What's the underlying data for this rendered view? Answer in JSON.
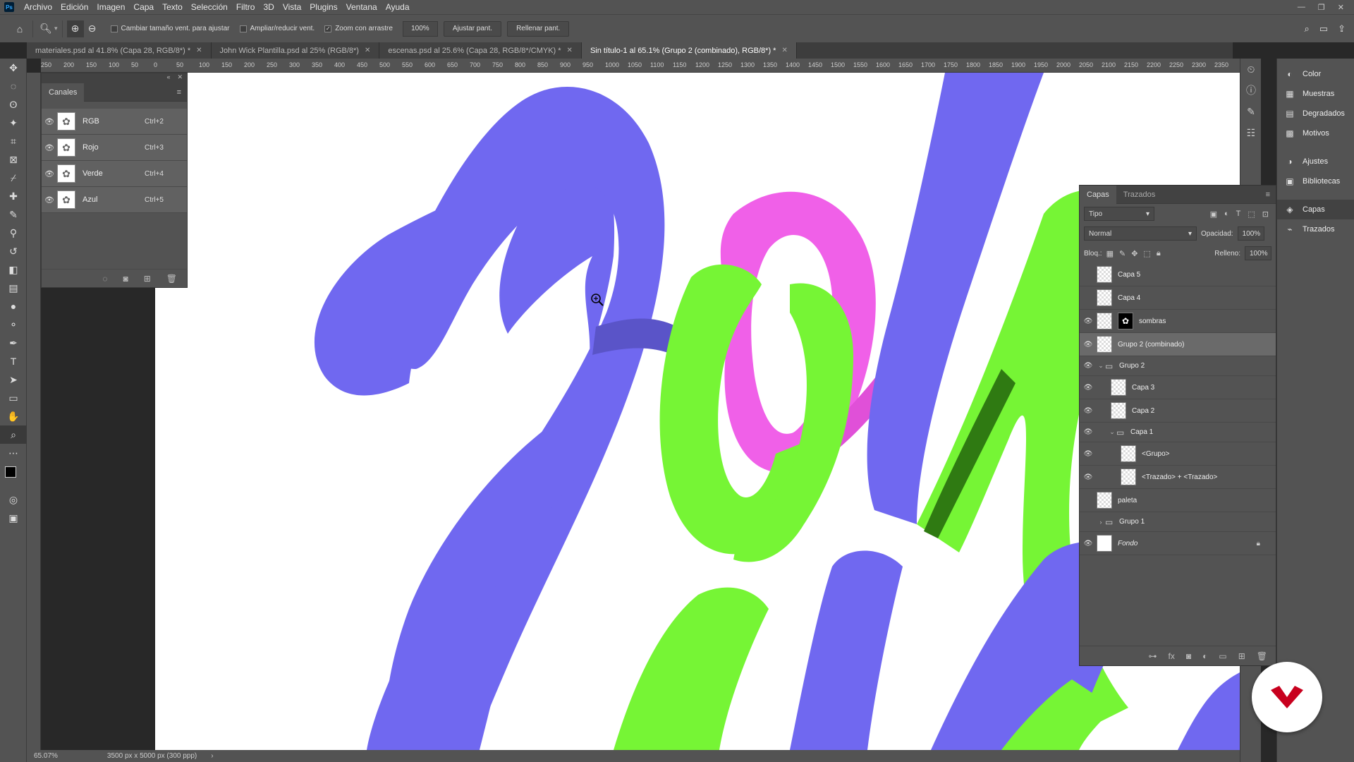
{
  "menubar": {
    "app_icon": "Ps",
    "items": [
      "Archivo",
      "Edición",
      "Imagen",
      "Capa",
      "Texto",
      "Selección",
      "Filtro",
      "3D",
      "Vista",
      "Plugins",
      "Ventana",
      "Ayuda"
    ]
  },
  "options": {
    "check1": "Cambiar tamaño vent. para ajustar",
    "check2": "Ampliar/reducir vent.",
    "check3": "Zoom con arrastre",
    "zoom_value": "100%",
    "btn_fit": "Ajustar pant.",
    "btn_fill": "Rellenar pant."
  },
  "tabs": [
    {
      "label": "materiales.psd al 41.8% (Capa 28, RGB/8*) *"
    },
    {
      "label": "John Wick Plantilla.psd al 25% (RGB/8*)"
    },
    {
      "label": "escenas.psd al 25.6% (Capa 28, RGB/8*/CMYK) *"
    },
    {
      "label": "Sin título-1 al 65.1% (Grupo 2 (combinado), RGB/8*) *"
    }
  ],
  "ruler": [
    "250",
    "200",
    "150",
    "100",
    "50",
    "0",
    "50",
    "100",
    "150",
    "200",
    "250",
    "300",
    "350",
    "400",
    "450",
    "500",
    "550",
    "600",
    "650",
    "700",
    "750",
    "800",
    "850",
    "900",
    "950",
    "1000",
    "1050",
    "1100",
    "1150",
    "1200",
    "1250",
    "1300",
    "1350",
    "1400",
    "1450",
    "1500",
    "1550",
    "1600",
    "1650",
    "1700",
    "1750",
    "1800",
    "1850",
    "1900",
    "1950",
    "2000",
    "2050",
    "2100",
    "2150",
    "2200",
    "2250",
    "2300",
    "2350"
  ],
  "channels": {
    "title": "Canales",
    "rows": [
      {
        "name": "RGB",
        "key": "Ctrl+2"
      },
      {
        "name": "Rojo",
        "key": "Ctrl+3"
      },
      {
        "name": "Verde",
        "key": "Ctrl+4"
      },
      {
        "name": "Azul",
        "key": "Ctrl+5"
      }
    ]
  },
  "right_panels": {
    "items": [
      "Color",
      "Muestras",
      "Degradados",
      "Motivos",
      "Ajustes",
      "Bibliotecas",
      "Capas",
      "Trazados"
    ]
  },
  "layers": {
    "tab_layers": "Capas",
    "tab_paths": "Trazados",
    "filter": "Tipo",
    "blend": "Normal",
    "opacity_label": "Opacidad:",
    "opacity": "100%",
    "lock_label": "Bloq.:",
    "fill_label": "Relleno:",
    "fill": "100%",
    "rows": [
      {
        "name": "Capa 5"
      },
      {
        "name": "Capa 4"
      },
      {
        "name": "sombras"
      },
      {
        "name": "Grupo 2 (combinado)"
      },
      {
        "name": "Grupo 2"
      },
      {
        "name": "Capa 3"
      },
      {
        "name": "Capa 2"
      },
      {
        "name": "Capa 1"
      },
      {
        "name": "<Grupo>"
      },
      {
        "name": "<Trazado> + <Trazado>"
      },
      {
        "name": "paleta"
      },
      {
        "name": "Grupo 1"
      },
      {
        "name": "Fondo"
      }
    ]
  },
  "status": {
    "zoom": "65.07%",
    "doc_size": "3500 px x 5000 px (300 ppp)"
  },
  "colors": {
    "purple": "#7068f0",
    "green": "#76f535",
    "pink": "#f060e8"
  }
}
